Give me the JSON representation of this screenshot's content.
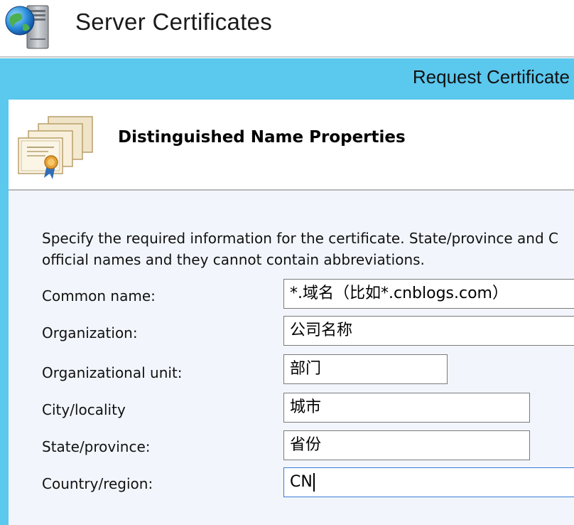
{
  "header": {
    "title": "Server Certificates",
    "icon": "server-globe-icon"
  },
  "dialog": {
    "title": "Request Certificate",
    "section_title": "Distinguished Name Properties",
    "section_icon": "certificate-icon",
    "instructions": [
      "Specify the required information for the certificate. State/province and C",
      "official names and they cannot contain abbreviations."
    ]
  },
  "form": {
    "common_name": {
      "label": "Common name:",
      "value": "*.域名（比如*.cnblogs.com）"
    },
    "organization": {
      "label": "Organization:",
      "value": "公司名称"
    },
    "organizational_unit": {
      "label": "Organizational unit:",
      "value": "部门"
    },
    "city": {
      "label": "City/locality",
      "value": "城市"
    },
    "state": {
      "label": "State/province:",
      "value": "省份"
    },
    "country": {
      "label": "Country/region:",
      "value": "CN"
    }
  },
  "colors": {
    "dialog_frame": "#5bc8ee",
    "content_bg": "#f2f6fc",
    "focus_border": "#3a7ad8"
  }
}
